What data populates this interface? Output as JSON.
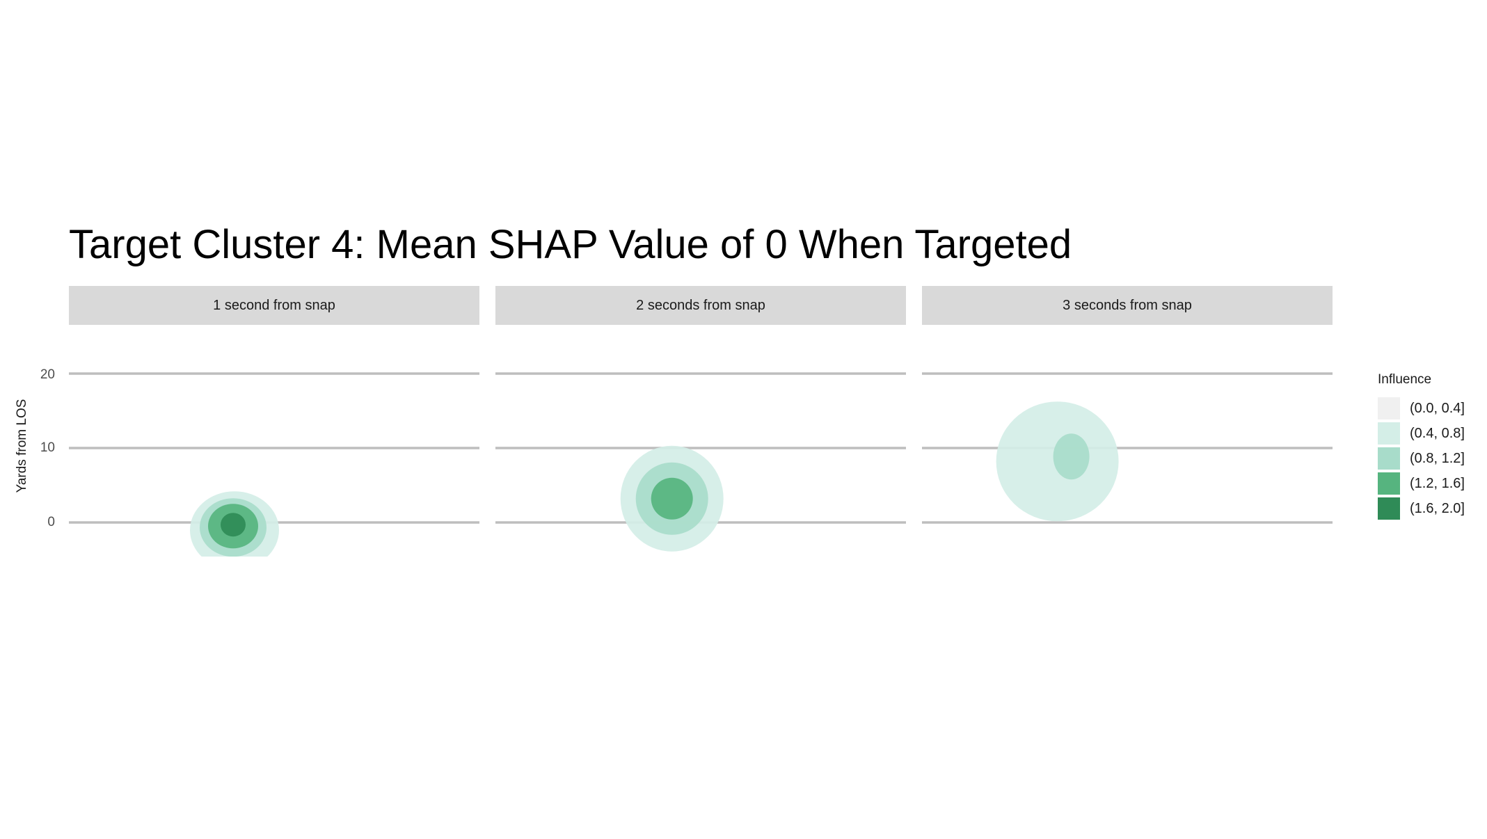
{
  "chart_data": {
    "type": "contour",
    "title": "Target Cluster 4: Mean SHAP Value of 0 When Targeted",
    "ylabel": "Yards from LOS",
    "xlabel": "",
    "y_ticks": [
      "0",
      "10",
      "20"
    ],
    "ylim": [
      -5,
      22
    ],
    "grid": "horizontal",
    "legend_placement": "right",
    "legend": {
      "title": "Influence",
      "entries": [
        {
          "label": "(0.0, 0.4]",
          "color": "#f0f0f0"
        },
        {
          "label": "(0.4, 0.8]",
          "color": "#d4eee7"
        },
        {
          "label": "(0.8, 1.2]",
          "color": "#a8dcca"
        },
        {
          "label": "(1.2, 1.6]",
          "color": "#56b47f"
        },
        {
          "label": "(1.6, 2.0]",
          "color": "#2f8b57"
        }
      ]
    },
    "panels": [
      {
        "label": "1 second from snap",
        "x_center": 0.4,
        "y_center": -0.3,
        "max_level": "(1.6, 2.0]"
      },
      {
        "label": "2 seconds from snap",
        "x_center": 0.43,
        "y_center": 3.2,
        "max_level": "(1.2, 1.6]"
      },
      {
        "label": "3 seconds from snap",
        "x_center": 0.34,
        "y_center": 8.2,
        "max_level": "(0.8, 1.2]"
      }
    ]
  }
}
